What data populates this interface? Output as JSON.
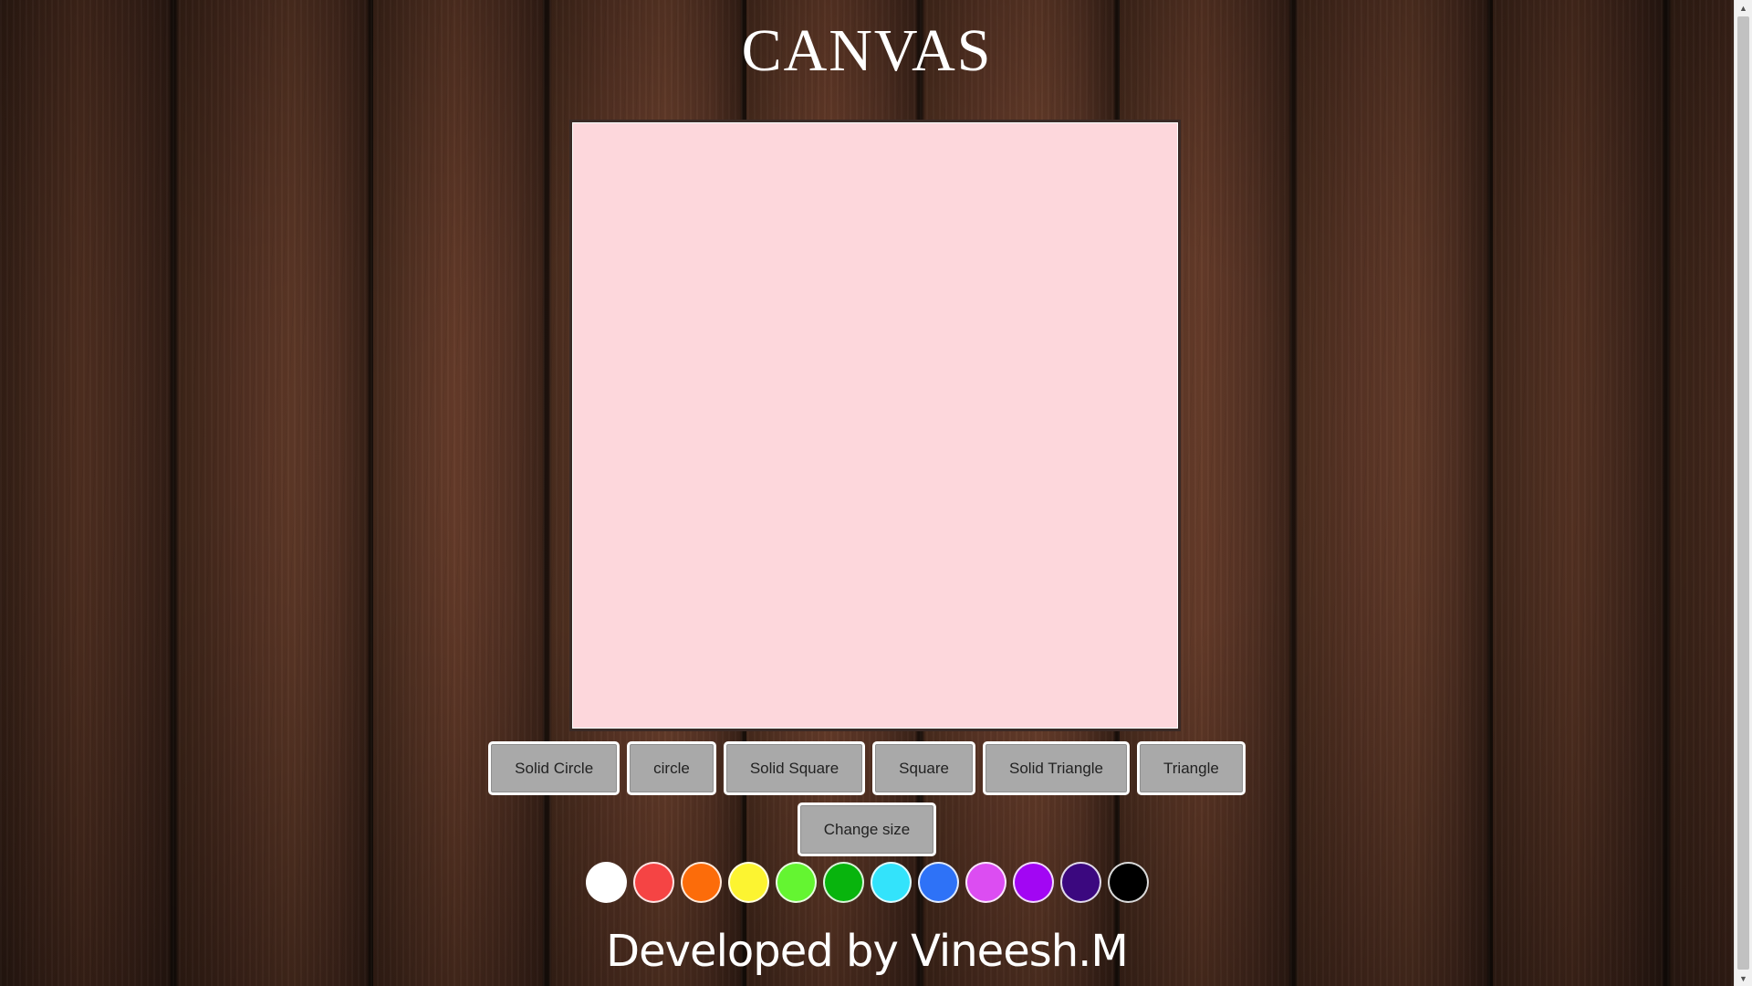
{
  "page": {
    "title": "CANVAS",
    "footer": "Developed by Vineesh.M",
    "canvas_background": "#fdd7dc"
  },
  "shape_buttons": [
    {
      "label": "Solid Circle",
      "name": "solid-circle-button"
    },
    {
      "label": "circle",
      "name": "circle-button"
    },
    {
      "label": "Solid Square",
      "name": "solid-square-button"
    },
    {
      "label": "Square",
      "name": "square-button"
    },
    {
      "label": "Solid Triangle",
      "name": "solid-triangle-button"
    },
    {
      "label": "Triangle",
      "name": "triangle-button"
    }
  ],
  "size_button": {
    "label": "Change size"
  },
  "colors": [
    {
      "name": "white",
      "hex": "#ffffff"
    },
    {
      "name": "red",
      "hex": "#f54444"
    },
    {
      "name": "orange",
      "hex": "#fc6c0a"
    },
    {
      "name": "yellow",
      "hex": "#fcf431"
    },
    {
      "name": "light-green",
      "hex": "#64f531"
    },
    {
      "name": "green",
      "hex": "#08b40d"
    },
    {
      "name": "cyan",
      "hex": "#33e3fb"
    },
    {
      "name": "blue",
      "hex": "#2e72f7"
    },
    {
      "name": "pink",
      "hex": "#dc4df2"
    },
    {
      "name": "purple",
      "hex": "#a206f3"
    },
    {
      "name": "indigo",
      "hex": "#3b087f"
    },
    {
      "name": "black",
      "hex": "#000000"
    }
  ],
  "scrollbar": {
    "up_icon": "▲",
    "down_icon": "▼"
  }
}
